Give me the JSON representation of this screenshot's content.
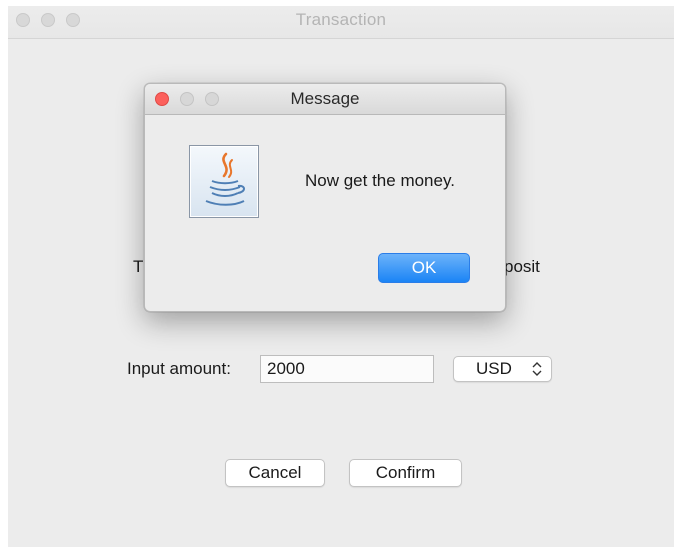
{
  "window": {
    "title": "Transaction"
  },
  "form": {
    "partial_left": "T",
    "partial_right": "posit",
    "amount_label": "Input amount:",
    "amount_value": "2000",
    "currency_selected": "USD",
    "currency_arrows": "⌃⌄",
    "cancel_label": "Cancel",
    "confirm_label": "Confirm"
  },
  "dialog": {
    "title": "Message",
    "message": "Now get the money.",
    "ok_label": "OK",
    "icon": "java-icon"
  },
  "colors": {
    "close_red": "#fc605c",
    "ok_blue": "#1b84f5",
    "window_bg": "#ececec"
  }
}
